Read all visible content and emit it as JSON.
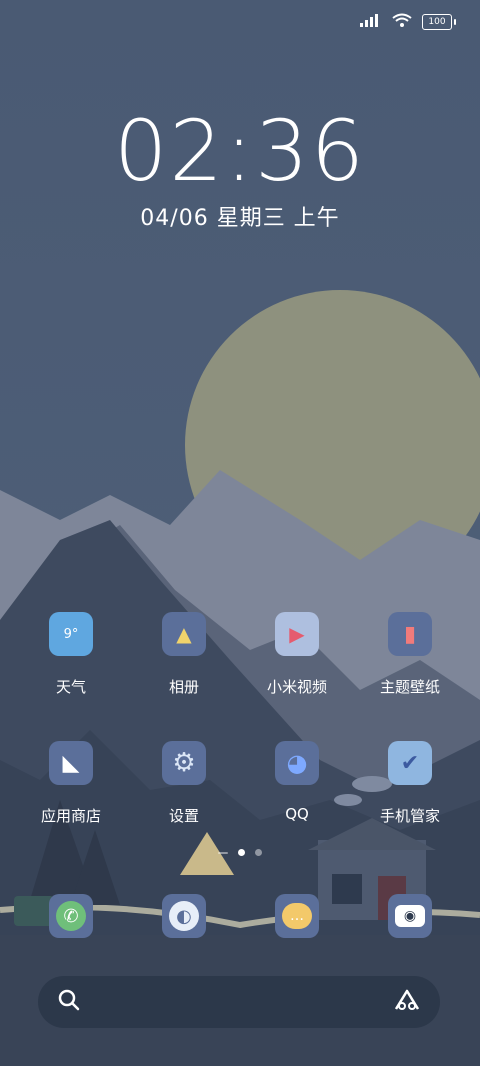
{
  "status_bar": {
    "signal_icon": "signal-icon",
    "wifi_icon": "wifi-icon",
    "battery_level": "100"
  },
  "lock": {
    "time": "02:36",
    "date": "04/06 星期三 上午"
  },
  "apps_row1": [
    {
      "name": "天气",
      "icon": "weather-icon",
      "bg": "#5fa7e0",
      "glyph": "9°"
    },
    {
      "name": "相册",
      "icon": "gallery-icon",
      "bg": "#5b6f9a",
      "glyph": "▲"
    },
    {
      "name": "小米视频",
      "icon": "video-icon",
      "bg": "#aebfdf",
      "glyph": "▶"
    },
    {
      "name": "主题壁纸",
      "icon": "theme-icon",
      "bg": "#5b6f9a",
      "glyph": "▮"
    }
  ],
  "apps_row2": [
    {
      "name": "应用商店",
      "icon": "app-store-icon",
      "bg": "#5b6f9a",
      "glyph": "◣"
    },
    {
      "name": "设置",
      "icon": "settings-icon",
      "bg": "#5b6f9a",
      "glyph": "⚙"
    },
    {
      "name": "QQ",
      "icon": "qq-icon",
      "bg": "#5b6f9a",
      "glyph": "◕"
    },
    {
      "name": "手机管家",
      "icon": "security-icon",
      "bg": "#8fb6e0",
      "glyph": "✔"
    }
  ],
  "dock": [
    {
      "icon": "phone-icon",
      "bg": "#5b6f9a",
      "glyph": "✆",
      "color": "#6fbf7a"
    },
    {
      "icon": "browser-icon",
      "bg": "#5b6f9a",
      "glyph": "◐",
      "color": "#e7eef8"
    },
    {
      "icon": "messages-icon",
      "bg": "#5b6f9a",
      "glyph": "…",
      "color": "#f3c96a"
    },
    {
      "icon": "camera-icon",
      "bg": "#5b6f9a",
      "glyph": "◉",
      "color": "#ffffff"
    }
  ],
  "pages": {
    "count": 3,
    "active": 1
  },
  "search": {
    "search_icon": "search-icon",
    "assistant_icon": "assistant-icon"
  }
}
